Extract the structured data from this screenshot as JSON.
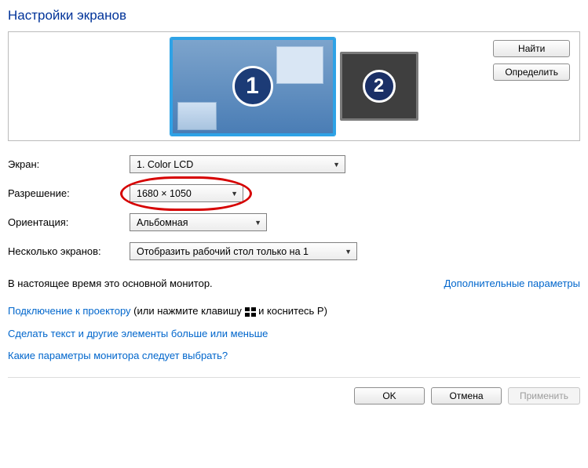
{
  "title": "Настройки экранов",
  "monitors": {
    "m1": "1",
    "m2": "2"
  },
  "buttons": {
    "find": "Найти",
    "identify": "Определить",
    "ok": "OK",
    "cancel": "Отмена",
    "apply": "Применить"
  },
  "labels": {
    "screen": "Экран:",
    "resolution": "Разрешение:",
    "orientation": "Ориентация:",
    "multiple": "Несколько экранов:"
  },
  "values": {
    "screen": "1. Color LCD",
    "resolution": "1680 × 1050",
    "orientation": "Альбомная",
    "multiple": "Отобразить рабочий стол только на 1"
  },
  "info": {
    "primary": "В настоящее время это основной монитор.",
    "advanced": "Дополнительные параметры"
  },
  "links": {
    "projector_link": "Подключение к проектору",
    "projector_hint_pre": " (или нажмите клавишу ",
    "projector_hint_post": " и коснитесь Р)",
    "text_size": "Сделать текст и другие элементы больше или меньше",
    "which_params": "Какие параметры монитора следует выбрать?"
  }
}
